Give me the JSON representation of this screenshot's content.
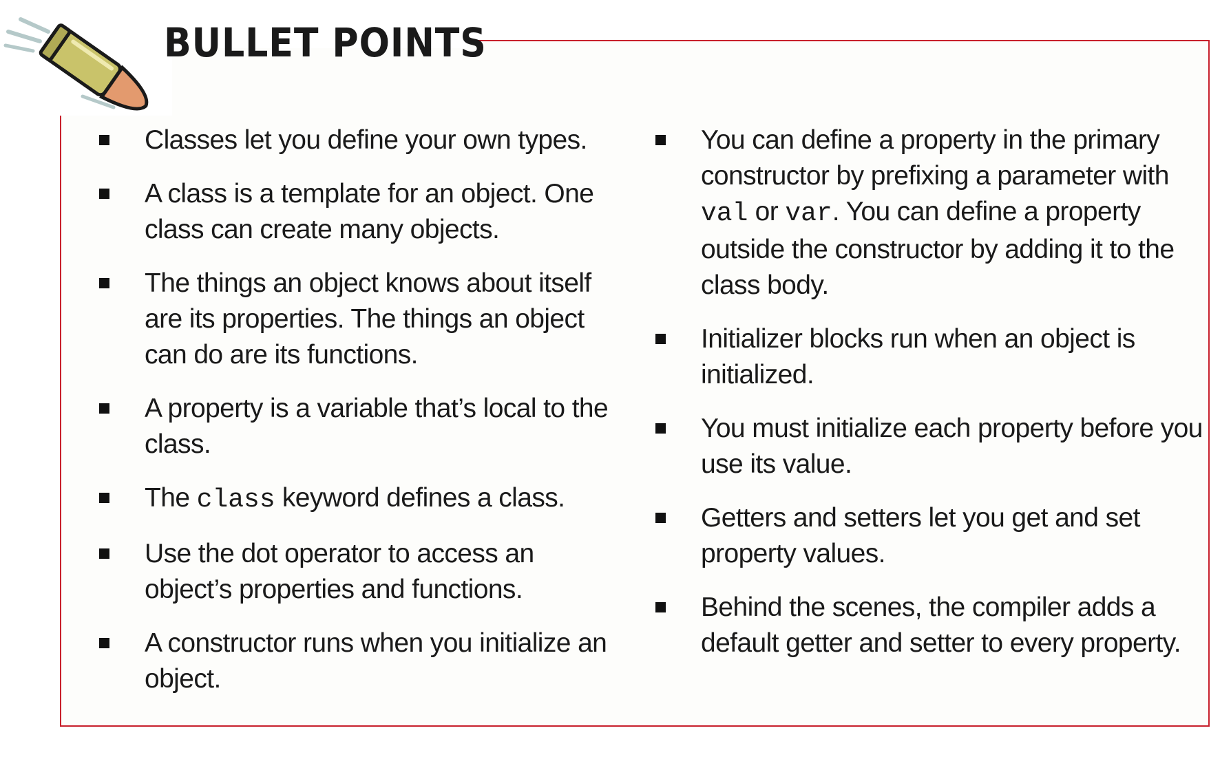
{
  "title": "BULLET POINTS",
  "colors": {
    "frame": "#c8202c",
    "text": "#1a1a1a",
    "bullet_casing": "#c9c36a",
    "bullet_tip": "#e39a6e"
  },
  "left_column": [
    {
      "text": "Classes let you define your own types."
    },
    {
      "text": "A class is a template for an object. One class can create many objects."
    },
    {
      "text": "The things an object knows about itself are its properties. The things an object can do are its functions."
    },
    {
      "text": "A property is a variable that’s local to the class."
    },
    {
      "text_before": "The ",
      "code": "class",
      "text_after": " keyword defines a class."
    },
    {
      "text": "Use the dot operator to access an object’s properties and functions."
    },
    {
      "text": "A constructor runs when you initialize an object."
    }
  ],
  "right_column": [
    {
      "text_before": "You can define a property in the primary constructor by prefixing a parameter with ",
      "code1": "val",
      "text_mid": " or ",
      "code2": "var",
      "text_after": ". You can define a property outside the constructor by adding it to the class body."
    },
    {
      "text": "Initializer blocks run when an object is initialized."
    },
    {
      "text": "You must initialize each property before you use its value."
    },
    {
      "text": "Getters and setters let you get and set property values."
    },
    {
      "text": "Behind the scenes, the compiler adds a default getter and setter to every property."
    }
  ]
}
